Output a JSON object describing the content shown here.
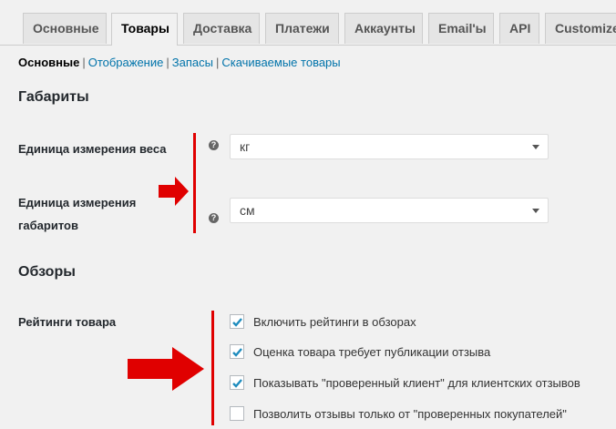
{
  "tabs": [
    {
      "label": "Основные",
      "active": false
    },
    {
      "label": "Товары",
      "active": true
    },
    {
      "label": "Доставка",
      "active": false
    },
    {
      "label": "Платежи",
      "active": false
    },
    {
      "label": "Аккаунты",
      "active": false
    },
    {
      "label": "Email'ы",
      "active": false
    },
    {
      "label": "API",
      "active": false
    },
    {
      "label": "Customize",
      "active": false
    }
  ],
  "subnav": {
    "current": "Основные",
    "links": [
      "Отображение",
      "Запасы",
      "Скачиваемые товары"
    ],
    "separator": "|"
  },
  "dimensions": {
    "title": "Габариты",
    "weight": {
      "label": "Единица измерения веса",
      "value": "кг",
      "help": "?"
    },
    "size": {
      "label_line1": "Единица измерения",
      "label_line2": "габаритов",
      "value": "см",
      "help": "?"
    }
  },
  "reviews": {
    "title": "Обзоры",
    "ratings_label": "Рейтинги товара",
    "options": [
      {
        "label": "Включить рейтинги в обзорах",
        "checked": true
      },
      {
        "label": "Оценка товара требует публикации отзыва",
        "checked": true
      },
      {
        "label": "Показывать \"проверенный клиент\" для клиентских отзывов",
        "checked": true
      },
      {
        "label": "Позволить отзывы только от \"проверенных покупателей\"",
        "checked": false
      }
    ]
  },
  "colors": {
    "accent_link": "#0073aa",
    "annotation_red": "#e00000",
    "checkbox_check": "#1e8cbe"
  }
}
